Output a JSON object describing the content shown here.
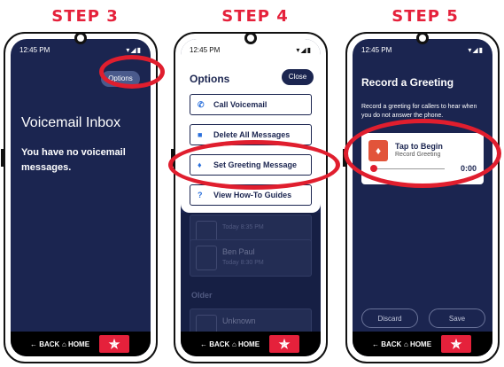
{
  "steps": [
    {
      "label": "STEP 3"
    },
    {
      "label": "STEP 4"
    },
    {
      "label": "STEP 5"
    }
  ],
  "status": {
    "time": "12:45 PM",
    "icons": "▾◢▮"
  },
  "nav": {
    "back": "← BACK",
    "home": "⌂ HOME",
    "star": "✯"
  },
  "phone1": {
    "options_label": "Options",
    "title": "Voicemail Inbox",
    "message": "You have no voicemail messages."
  },
  "phone2": {
    "title": "Options",
    "close_label": "Close",
    "menu": [
      {
        "label": "Call Voicemail",
        "icon": "phone-icon",
        "glyph": "✆"
      },
      {
        "label": "Delete All Messages",
        "icon": "trash-icon",
        "glyph": "■"
      },
      {
        "label": "Set Greeting Message",
        "icon": "mic-icon",
        "glyph": "♦"
      },
      {
        "label": "View How-To Guides",
        "icon": "help-icon",
        "glyph": "?"
      }
    ],
    "cards": [
      {
        "name": "",
        "sub": "Today   8:35 PM"
      },
      {
        "name": "Ben Paul",
        "sub": "Today   8:30 PM"
      },
      {
        "name": "Unknown",
        "sub": ""
      }
    ],
    "older_label": "Older"
  },
  "phone3": {
    "title": "Record a Greeting",
    "description": "Record a greeting for callers to hear when you do not answer the phone.",
    "tap_label": "Tap to Begin",
    "record_sub": "Record Greeting",
    "time": "0:00",
    "discard_label": "Discard",
    "save_label": "Save"
  },
  "colors": {
    "accent": "#e5213b",
    "screen_bg": "#1b2550",
    "highlight_ring": "#e01e2e"
  }
}
